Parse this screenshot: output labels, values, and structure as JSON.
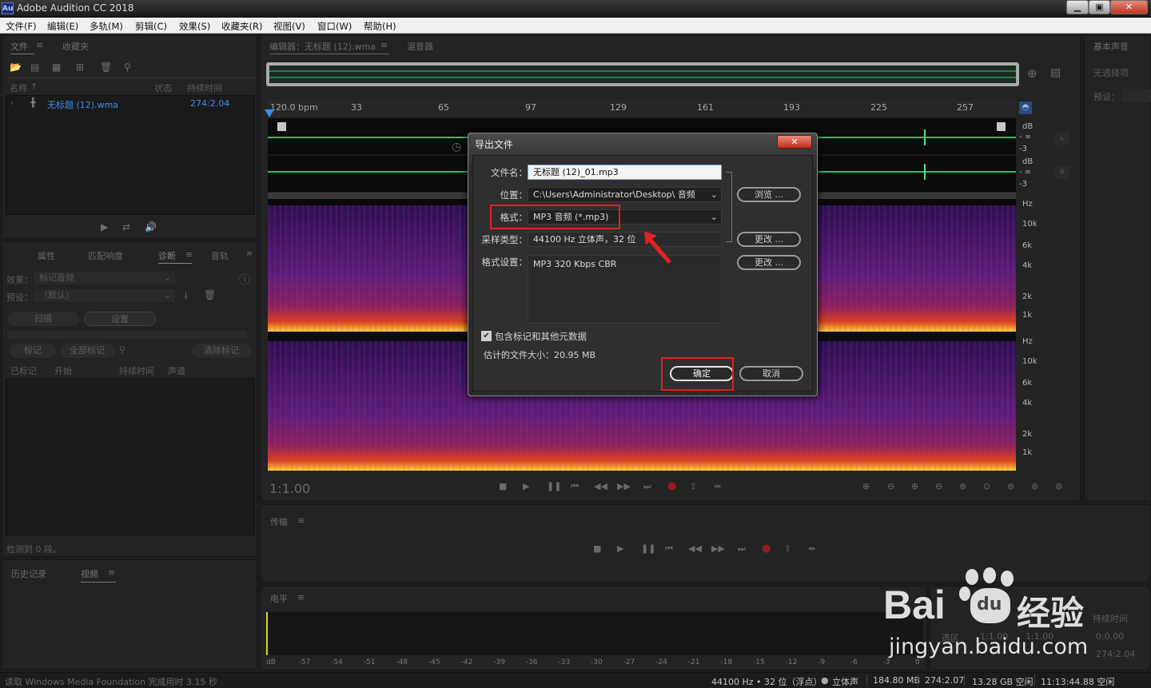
{
  "app": {
    "icon_text": "Au",
    "title": "Adobe Audition CC 2018"
  },
  "menu": [
    "文件(F)",
    "编辑(E)",
    "多轨(M)",
    "剪辑(C)",
    "效果(S)",
    "收藏夹(R)",
    "视图(V)",
    "窗口(W)",
    "帮助(H)"
  ],
  "files_panel": {
    "tab_files": "文件",
    "tab_fav": "收藏夹",
    "col_name": "名称",
    "col_status": "状态",
    "col_duration": "持续时间",
    "file_name": "无标题 (12).wma",
    "file_duration": "274:2.04"
  },
  "diag_panel": {
    "tabs": [
      "属性",
      "匹配响度",
      "诊断",
      "音轨"
    ],
    "effect_label": "效果：",
    "effect_value": "标记音频",
    "preset_label": "预设：",
    "preset_value": "（默认）",
    "scan_btn": "扫描",
    "settings_btn": "设置",
    "mark_btn": "标记",
    "mark_all_btn": "全部标记",
    "clear_btn": "清除标记",
    "cols": [
      "已标记",
      "开始",
      "持续时间",
      "声道"
    ],
    "status_text": "检测到 0 段。"
  },
  "history_panel": {
    "tab_history": "历史记录",
    "tab_video": "视频"
  },
  "editor": {
    "tab_editor": "编辑器：无标题 (12).wma",
    "tab_mixer": "混音器",
    "bpm": "120.0 bpm",
    "ticks": [
      "33",
      "65",
      "97",
      "129",
      "161",
      "193",
      "225",
      "257"
    ],
    "db_label": "dB",
    "neg_inf": "- ∞",
    "neg3": "-3",
    "chan_l": "L",
    "chan_r": "R",
    "hz": "Hz",
    "freq_labels": [
      "10k",
      "6k",
      "4k",
      "2k",
      "1k"
    ],
    "time": "1:1.00"
  },
  "essential_panel": {
    "title": "基本声音",
    "no_selection": "无选择项",
    "preset": "预设："
  },
  "transport_panel": {
    "title": "传输"
  },
  "levels_panel": {
    "title": "电平",
    "scale": [
      "dB",
      "-57",
      "-54",
      "-51",
      "-48",
      "-45",
      "-42",
      "-39",
      "-36",
      "-33",
      "-30",
      "-27",
      "-24",
      "-21",
      "-18",
      "-15",
      "-12",
      "-9",
      "-6",
      "-3",
      "0"
    ]
  },
  "selection_panel": {
    "duration": "持续时间",
    "sel": "选区",
    "start": "1:1.00",
    "end": "1:1.00",
    "t1": "0:0.00",
    "t2": "274:2.04"
  },
  "dialog": {
    "title": "导出文件",
    "filename_label": "文件名：",
    "filename": "无标题 (12)_01.mp3",
    "location_label": "位置：",
    "location": "C:\\Users\\Administrator\\Desktop\\ 音频",
    "browse": "浏览 ...",
    "format_label": "格式：",
    "format": "MP3 音频 (*.mp3)",
    "sample_label": "采样类型：",
    "sample": "44100 Hz 立体声，32 位",
    "change": "更改 ...",
    "fmt_settings_label": "格式设置：",
    "fmt_settings": "MP3 320 Kbps CBR",
    "include_meta": "包含标记和其他元数据",
    "est_size": "估计的文件大小：20.95 MB",
    "ok": "确定",
    "cancel": "取消"
  },
  "status": {
    "left": "读取 Windows Media Foundation 完成用时 3.15 秒",
    "rate": "44100 Hz • 32 位（浮点）",
    "stereo": "立体声",
    "mem": "184.80 MB",
    "dur": "274:2.07",
    "disk": "13.28 GB 空闲",
    "clock": "11:13:44.88 空闲"
  },
  "watermark": {
    "brand": "Bai",
    "brand2": "du",
    "brand_cn": "经验",
    "url": "jingyan.baidu.com"
  }
}
